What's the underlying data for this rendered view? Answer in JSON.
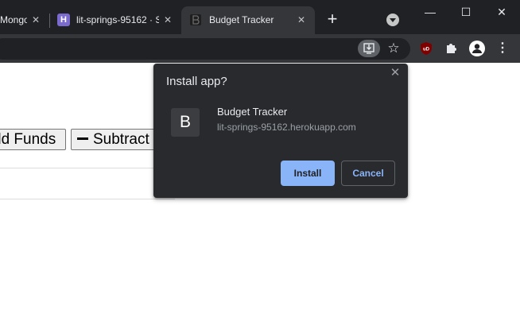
{
  "browser": {
    "tabs": [
      {
        "title": "Mongo",
        "favicon": "mongodb-icon",
        "active": false
      },
      {
        "title": "lit-springs-95162 · S",
        "favicon": "heroku-icon",
        "active": false
      },
      {
        "title": "Budget Tracker",
        "favicon": "budget-tracker-icon",
        "active": true
      }
    ],
    "tab_close_glyph": "✕",
    "new_tab_glyph": "+",
    "window_controls": {
      "minimize": "—",
      "maximize": "☐",
      "close": "✕"
    },
    "heroku_letter": "H",
    "toolbar": {
      "star_glyph": "☆",
      "puzzle_glyph": "🧩",
      "menu_glyph": "⋮",
      "ublock_label": "uD"
    }
  },
  "page": {
    "buttons": {
      "add_funds": "dd Funds",
      "subtract_funds": "Subtract"
    }
  },
  "install_dialog": {
    "title": "Install app?",
    "close_glyph": "✕",
    "app_icon_letter": "B",
    "app_name": "Budget Tracker",
    "app_origin": "lit-springs-95162.herokuapp.com",
    "install_label": "Install",
    "cancel_label": "Cancel"
  },
  "colors": {
    "tabstrip_bg": "#202124",
    "toolbar_bg": "#35363a",
    "dialog_bg": "#292a2d",
    "accent": "#8ab4f8"
  }
}
